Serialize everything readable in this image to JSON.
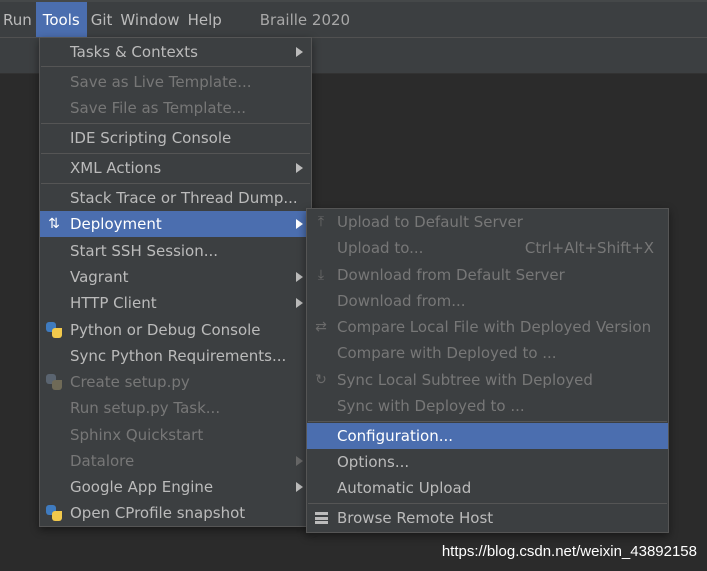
{
  "menubar": {
    "items": [
      {
        "label": "Run"
      },
      {
        "label": "Tools",
        "active": true
      },
      {
        "label": "Git"
      },
      {
        "label": "Window"
      },
      {
        "label": "Help"
      }
    ],
    "project": "Braille 2020"
  },
  "tools_menu": {
    "items": [
      {
        "label": "Tasks & Contexts",
        "submenu": true
      },
      {
        "label": "Save as Live Template...",
        "disabled": true
      },
      {
        "label": "Save File as Template...",
        "disabled": true
      },
      {
        "label": "IDE Scripting Console"
      },
      {
        "label": "XML Actions",
        "submenu": true
      },
      {
        "label": "Stack Trace or Thread Dump..."
      },
      {
        "label": "Deployment",
        "submenu": true,
        "selected": true,
        "icon": "deploy-arrows-icon"
      },
      {
        "label": "Start SSH Session..."
      },
      {
        "label": "Vagrant",
        "submenu": true
      },
      {
        "label": "HTTP Client",
        "submenu": true
      },
      {
        "label": "Python or Debug Console",
        "icon": "python-icon"
      },
      {
        "label": "Sync Python Requirements..."
      },
      {
        "label": "Create setup.py",
        "disabled": true,
        "icon": "python-setup-icon"
      },
      {
        "label": "Run setup.py Task...",
        "disabled": true
      },
      {
        "label": "Sphinx Quickstart",
        "disabled": true
      },
      {
        "label": "Datalore",
        "disabled": true,
        "submenu": true
      },
      {
        "label": "Google App Engine",
        "submenu": true
      },
      {
        "label": "Open CProfile snapshot",
        "icon": "cprofile-icon"
      }
    ]
  },
  "deployment_menu": {
    "items": [
      {
        "label": "Upload to Default Server",
        "disabled": true,
        "icon": "upload-icon"
      },
      {
        "label": "Upload to...",
        "disabled": true,
        "shortcut": "Ctrl+Alt+Shift+X"
      },
      {
        "label": "Download from Default Server",
        "disabled": true,
        "icon": "download-icon"
      },
      {
        "label": "Download from...",
        "disabled": true
      },
      {
        "label": "Compare Local File with Deployed Version",
        "disabled": true,
        "icon": "compare-icon"
      },
      {
        "label": "Compare with Deployed to ...",
        "disabled": true
      },
      {
        "label": "Sync Local Subtree with Deployed",
        "disabled": true,
        "icon": "sync-icon"
      },
      {
        "label": "Sync with Deployed to ...",
        "disabled": true
      },
      {
        "label": "Configuration...",
        "selected": true
      },
      {
        "label": "Options..."
      },
      {
        "label": "Automatic Upload"
      },
      {
        "label": "Browse Remote Host",
        "icon": "remote-host-icon"
      }
    ]
  },
  "watermark": "https://blog.csdn.net/weixin_43892158",
  "colors": {
    "menu_bg": "#3c3f41",
    "selection": "#4b6eaf",
    "text": "#bbbbbb",
    "disabled_text": "#777777",
    "editor_bg": "#2b2b2b"
  }
}
